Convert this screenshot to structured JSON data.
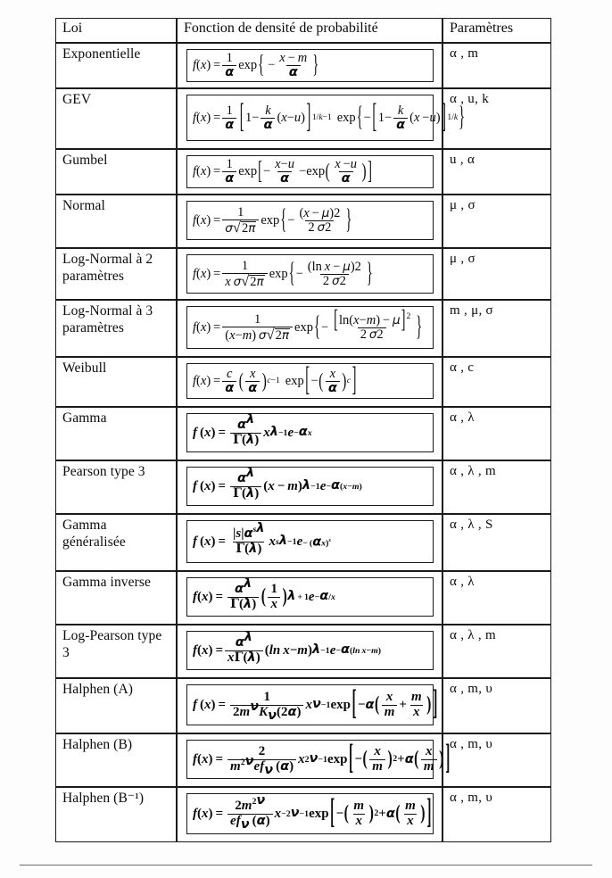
{
  "document": {
    "type": "probability-density-function-reference-table",
    "language": "fr"
  },
  "table": {
    "headers": {
      "loi": "Loi",
      "fonction": "Fonction de densité de probabilité",
      "parametres": "Paramètres"
    },
    "rows": [
      {
        "id": "exponentielle",
        "loi": "Exponentielle",
        "formula_text": "f(x) = (1/α) exp{ -(x-m)/α }",
        "parametres": "α , m"
      },
      {
        "id": "gev",
        "loi": "GEV",
        "formula_text": "f(x) = (1/α)[1 - (k/α)(x-u)]^(1/k-1) exp{ -[1 - (k/α)(x-u)]^(1/k) }",
        "parametres": "α , u, k"
      },
      {
        "id": "gumbel",
        "loi": "Gumbel",
        "formula_text": "f(x) = (1/α) exp[ -(x-u)/α - exp((x-u)/α) ]",
        "parametres": "u , α"
      },
      {
        "id": "normal",
        "loi": "Normal",
        "formula_text": "f(x) = 1/(σ√(2π)) exp{ -((x-μ)2)/(2σ2) }",
        "parametres": "μ , σ"
      },
      {
        "id": "lognormal2",
        "loi": "Log-Normal à 2 paramètres",
        "formula_text": "f(x) = 1/(x σ√(2π)) exp{ -((ln x - μ)2)/(2σ2) }",
        "parametres": "μ , σ"
      },
      {
        "id": "lognormal3",
        "loi": "Log-Normal à 3 paramètres",
        "formula_text": "f(x) = 1/((x-m) σ√(2π)) exp{ -[ln(x-m) - μ]²/(2σ2) }",
        "parametres": "m , μ, σ"
      },
      {
        "id": "weibull",
        "loi": "Weibull",
        "formula_text": "f(x) = (c/α)(x/α)^(c-1) exp[ -(x/α)^c ]",
        "parametres": "α , c"
      },
      {
        "id": "gamma",
        "loi": "Gamma",
        "formula_text": "f(x) = (α^λ / Γ(λ)) x^(λ-1) e^(-αx)",
        "parametres": "α , λ"
      },
      {
        "id": "pearson3",
        "loi": "Pearson type 3",
        "formula_text": "f(x) = (α^λ / Γ(λ)) (x-m)^(λ-1) e^(-α(x-m))",
        "parametres": "α , λ , m"
      },
      {
        "id": "gammagen",
        "loi": "Gamma généralisée",
        "formula_text": "f(x) = (|s| α^(sλ) / Γ(λ)) x^(sλ-1) e^(-(αx)^s)",
        "parametres": "α , λ , S"
      },
      {
        "id": "gammainv",
        "loi": "Gamma inverse",
        "formula_text": "f(x) = (α^λ / Γ(λ)) (1/x)^(λ+1) e^(-α/x)",
        "parametres": "α , λ"
      },
      {
        "id": "logpearson3",
        "loi": "Log-Pearson type 3",
        "formula_text": "f(x) = (α^λ / (x Γ(λ))) (ln x - m)^(λ-1) e^(-α(ln x - m))",
        "parametres": "α , λ , m"
      },
      {
        "id": "halphen-a",
        "loi": "Halphen (A)",
        "formula_text": "f(x) = 1/(2 m^ν K_ν(2α)) x^(ν-1) exp[ -α( x/m + m/x ) ]",
        "parametres": "α , m, υ"
      },
      {
        "id": "halphen-b",
        "loi": "Halphen (B)",
        "formula_text": "f(x) = 2/(m^(2ν) ef_ν(α)) x^(2ν-1) exp[ -(x/m)² + α(x/m) ]",
        "parametres": "α , m, υ"
      },
      {
        "id": "halphen-b-inv",
        "loi": "Halphen (B⁻¹)",
        "formula_text": "f(x) = 2 m^(2ν)/(ef_ν(α)) x^(-2ν-1) exp[ -(m/x)² + α(m/x) ]",
        "parametres": "α , m, υ"
      }
    ]
  }
}
